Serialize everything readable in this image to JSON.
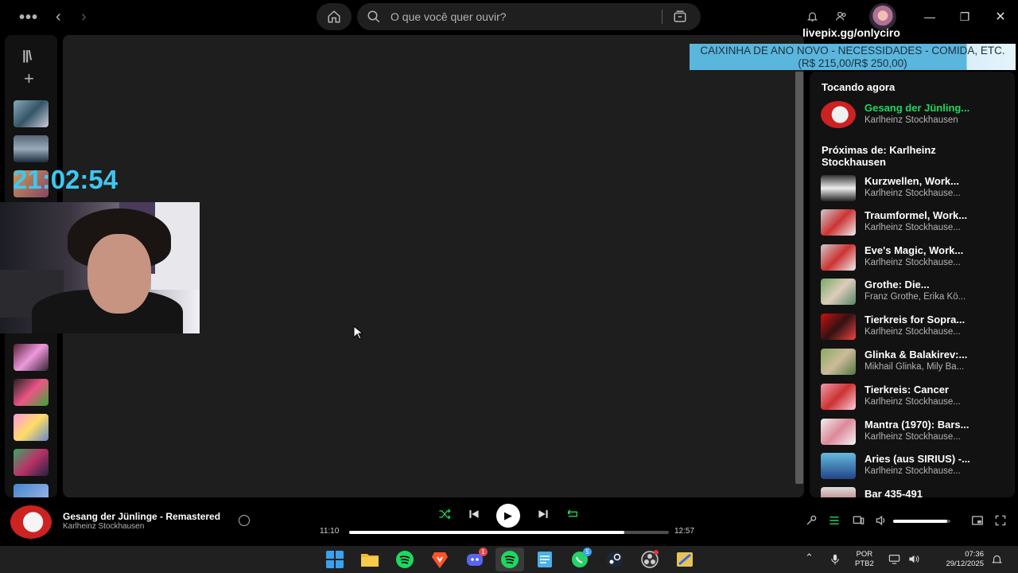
{
  "topbar": {
    "search_placeholder": "O que você quer ouvir?",
    "livepix": "livepix.gg/onlyciro"
  },
  "overlay": {
    "clock": "21:02:54",
    "banner_line1": "CAIXINHA DE ANO NOVO - NECESSIDADES - COMIDA, ETC.",
    "banner_line2": "(R$ 215,00/R$ 250,00)"
  },
  "queue": {
    "now_playing_header": "Tocando agora",
    "now_playing": {
      "title": "Gesang der Jünling...",
      "artist": "Karlheinz Stockhausen"
    },
    "next_header": "Próximas de: Karlheinz Stockhausen",
    "items": [
      {
        "title": "Kurzwellen, Work...",
        "artist": "Karlheinz Stockhause..."
      },
      {
        "title": "Traumformel, Work...",
        "artist": "Karlheinz Stockhause..."
      },
      {
        "title": "Eve's Magic, Work...",
        "artist": "Karlheinz Stockhause..."
      },
      {
        "title": "Grothe: Die...",
        "artist": "Franz Grothe, Erika Kö..."
      },
      {
        "title": "Tierkreis for Sopra...",
        "artist": "Karlheinz Stockhause..."
      },
      {
        "title": "Glinka & Balakirev:...",
        "artist": "Mikhail Glinka, Mily Ba..."
      },
      {
        "title": "Tierkreis: Cancer",
        "artist": "Karlheinz Stockhause..."
      },
      {
        "title": "Mantra (1970): Bars...",
        "artist": "Karlheinz Stockhause..."
      },
      {
        "title": "Aries (aus SIRIUS) -...",
        "artist": "Karlheinz Stockhause..."
      },
      {
        "title": "Bar 435-491",
        "artist": ""
      }
    ]
  },
  "player": {
    "title": "Gesang der Jünlinge - Remastered",
    "artist": "Karlheinz Stockhausen",
    "elapsed": "11:10",
    "duration": "12:57",
    "progress_fraction": 0.86,
    "volume_fraction": 0.95
  },
  "taskbar": {
    "lang_line1": "POR",
    "lang_line2": "PTB2",
    "time": "07:36",
    "date": "29/12/2025",
    "discord_badge": "1",
    "whatsapp_badge": "5"
  },
  "colors": {
    "accent": "#1ed760",
    "clock": "#3cc8f0",
    "banner": "#5ab6dc"
  }
}
